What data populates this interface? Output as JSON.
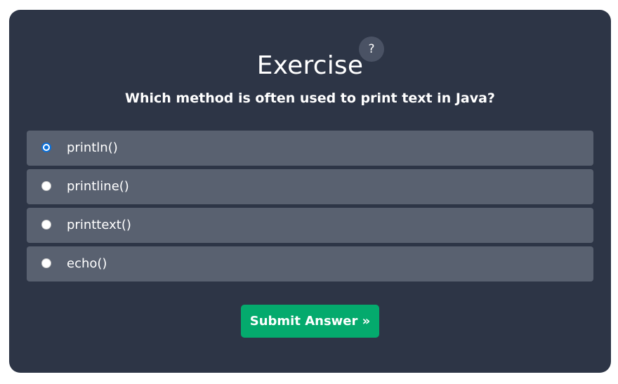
{
  "exercise": {
    "title": "Exercise",
    "help_label": "?",
    "question": "Which method is often used to print text in Java?",
    "options": [
      {
        "label": "println()",
        "selected": true
      },
      {
        "label": "printline()",
        "selected": false
      },
      {
        "label": "printtext()",
        "selected": false
      },
      {
        "label": "echo()",
        "selected": false
      }
    ],
    "submit_label": "Submit Answer »"
  },
  "colors": {
    "panel_bg": "#2d3546",
    "option_bg": "#596170",
    "submit_bg": "#04aa6d",
    "radio_selected": "#0a6fd8"
  }
}
